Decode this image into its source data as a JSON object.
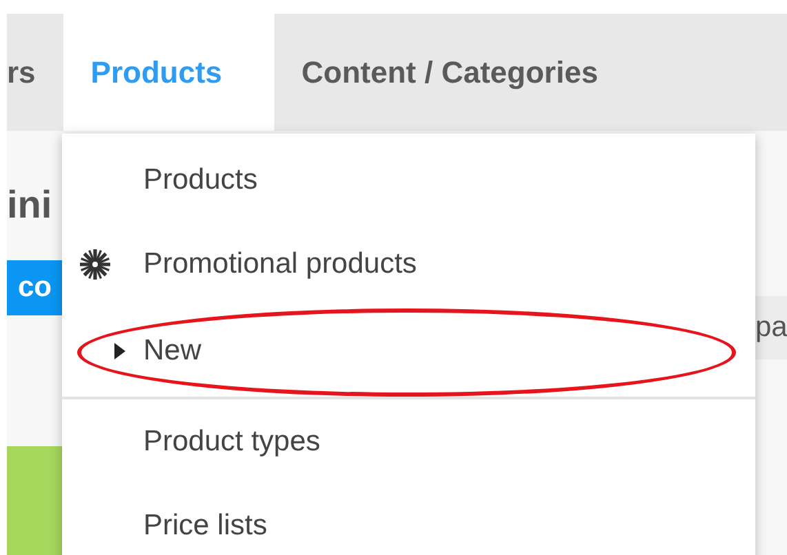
{
  "nav_tabs": [
    {
      "label": "rs",
      "selected": false
    },
    {
      "label": "Products",
      "selected": true
    },
    {
      "label": "Content / Categories",
      "selected": false
    }
  ],
  "page_behind": {
    "heading": "ini",
    "button": "co",
    "column": "pa"
  },
  "dropdown_menu": {
    "items": [
      {
        "label": "Products",
        "kind": "plain",
        "circled": false,
        "separator_below": false
      },
      {
        "label": "Promotional products",
        "kind": "icon",
        "circled": false,
        "separator_below": false
      },
      {
        "label": "New",
        "kind": "submenu",
        "circled": true,
        "separator_below": true
      },
      {
        "label": "Product types",
        "kind": "plain",
        "circled": false,
        "separator_below": false
      },
      {
        "label": "Price lists",
        "kind": "plain",
        "circled": false,
        "separator_below": false
      }
    ]
  }
}
